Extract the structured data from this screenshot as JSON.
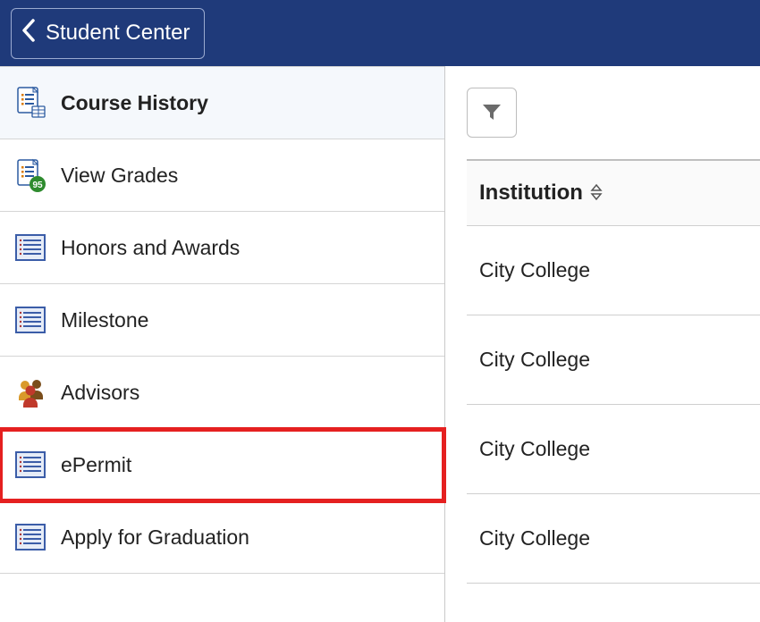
{
  "header": {
    "back_label": "Student Center"
  },
  "sidebar": {
    "items": [
      {
        "label": "Course History",
        "icon": "document-list-icon",
        "active": true
      },
      {
        "label": "View Grades",
        "icon": "grades-icon"
      },
      {
        "label": "Honors and Awards",
        "icon": "list-lines-icon"
      },
      {
        "label": "Milestone",
        "icon": "list-lines-icon"
      },
      {
        "label": "Advisors",
        "icon": "people-icon"
      },
      {
        "label": "ePermit",
        "icon": "list-lines-icon",
        "highlighted": true
      },
      {
        "label": "Apply for Graduation",
        "icon": "list-lines-icon"
      }
    ]
  },
  "content": {
    "column_header": "Institution",
    "rows": [
      {
        "institution": "City College"
      },
      {
        "institution": "City College"
      },
      {
        "institution": "City College"
      },
      {
        "institution": "City College"
      }
    ]
  }
}
